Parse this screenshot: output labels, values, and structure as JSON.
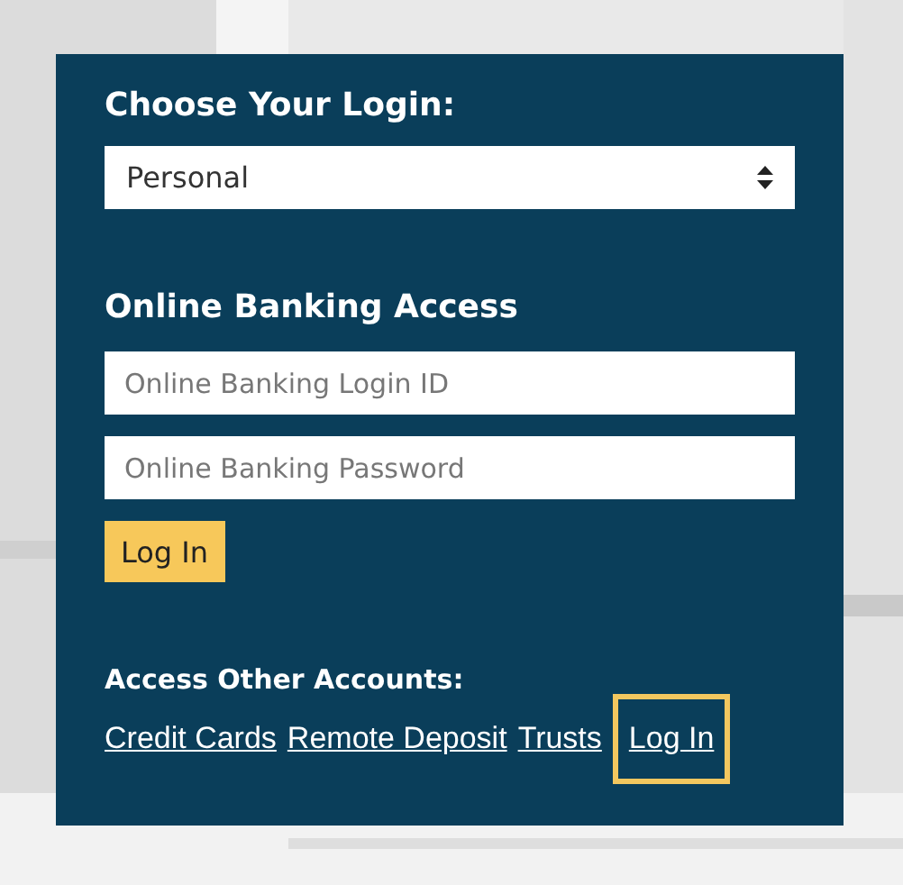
{
  "login_panel": {
    "choose_heading": "Choose Your Login:",
    "login_type": {
      "value": "Personal"
    },
    "access_heading": "Online Banking Access",
    "fields": [
      {
        "placeholder": "Online Banking Login ID"
      },
      {
        "placeholder": "Online Banking Password"
      }
    ],
    "login_button": "Log In",
    "other_heading": "Access Other Accounts:",
    "links": [
      {
        "label": "Credit Cards",
        "focused": false
      },
      {
        "label": "Remote Deposit",
        "focused": false
      },
      {
        "label": "Trusts",
        "focused": false
      },
      {
        "label": "Log In",
        "focused": true
      }
    ]
  }
}
